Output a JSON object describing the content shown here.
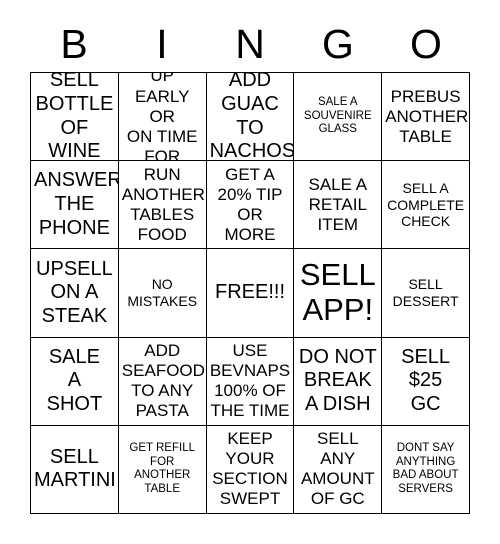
{
  "card": {
    "title": "BINGO",
    "header_letters": [
      "B",
      "I",
      "N",
      "G",
      "O"
    ],
    "rows": [
      [
        {
          "text": "SELL\nBOTTLE\nOF WINE",
          "size": "s-lg"
        },
        {
          "text": "SHOW UP\nEARLY OR\nON TIME\nFOR SHIFT",
          "size": "s-md"
        },
        {
          "text": "ADD\nGUAC TO\nNACHOS",
          "size": "s-lg"
        },
        {
          "text": "SALE A\nSOUVENIRE\nGLASS",
          "size": "s-xs"
        },
        {
          "text": "PREBUS\nANOTHER\nTABLE",
          "size": "s-md"
        }
      ],
      [
        {
          "text": "ANSWER\nTHE\nPHONE",
          "size": "s-lg"
        },
        {
          "text": "RUN\nANOTHER\nTABLES\nFOOD",
          "size": "s-md"
        },
        {
          "text": "GET A\n20% TIP\nOR\nMORE",
          "size": "s-md"
        },
        {
          "text": "SALE A\nRETAIL\nITEM",
          "size": "s-md"
        },
        {
          "text": "SELL A\nCOMPLETE\nCHECK",
          "size": "s-sm"
        }
      ],
      [
        {
          "text": "UPSELL\nON A\nSTEAK",
          "size": "s-lg"
        },
        {
          "text": "NO\nMISTAKES",
          "size": "s-sm"
        },
        {
          "text": "FREE!!!",
          "size": "s-lg"
        },
        {
          "text": "SELL\nAPP!",
          "size": "s-xl"
        },
        {
          "text": "SELL\nDESSERT",
          "size": "s-sm"
        }
      ],
      [
        {
          "text": "SALE\nA\nSHOT",
          "size": "s-lg"
        },
        {
          "text": "ADD\nSEAFOOD\nTO ANY\nPASTA",
          "size": "s-md"
        },
        {
          "text": "USE\nBEVNAPS\n100% OF\nTHE TIME",
          "size": "s-md"
        },
        {
          "text": "DO NOT\nBREAK\nA DISH",
          "size": "s-lg"
        },
        {
          "text": "SELL\n$25\nGC",
          "size": "s-lg"
        }
      ],
      [
        {
          "text": "SELL\nMARTINI",
          "size": "s-lg"
        },
        {
          "text": "GET REFILL\nFOR\nANOTHER\nTABLE",
          "size": "s-xs"
        },
        {
          "text": "KEEP\nYOUR\nSECTION\nSWEPT",
          "size": "s-md"
        },
        {
          "text": "SELL\nANY\nAMOUNT\nOF GC",
          "size": "s-md"
        },
        {
          "text": "DONT SAY\nANYTHING\nBAD ABOUT\nSERVERS",
          "size": "s-xs"
        }
      ]
    ],
    "colors": {
      "background": "#ffffff",
      "text": "#000000",
      "border": "#000000"
    }
  }
}
